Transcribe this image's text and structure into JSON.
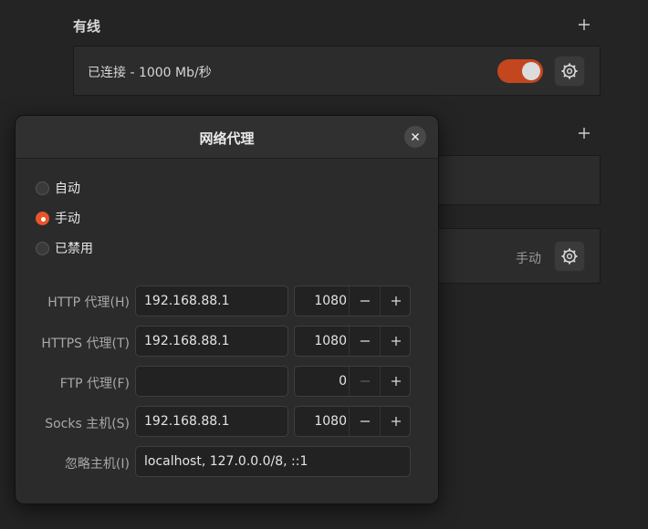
{
  "wired": {
    "section_title": "有线",
    "connection_label": "已连接 - 1000 Mb/秒",
    "connection_enabled": true
  },
  "proxy_row": {
    "value": "手动"
  },
  "dialog": {
    "title": "网络代理",
    "modes": [
      {
        "label": "自动",
        "checked": false
      },
      {
        "label": "手动",
        "checked": true
      },
      {
        "label": "已禁用",
        "checked": false
      }
    ],
    "fields": {
      "http": {
        "label": "HTTP 代理(H)",
        "host": "192.168.88.1",
        "port": "1080"
      },
      "https": {
        "label": "HTTPS 代理(T)",
        "host": "192.168.88.1",
        "port": "1080"
      },
      "ftp": {
        "label": "FTP 代理(F)",
        "host": "",
        "port": "0"
      },
      "socks": {
        "label": "Socks 主机(S)",
        "host": "192.168.88.1",
        "port": "1080"
      },
      "ignore": {
        "label": "忽略主机(I)",
        "value": "localhost, 127.0.0.0/8, ::1"
      }
    }
  },
  "colors": {
    "accent": "#e9552b",
    "toggle_on": "#c4461f"
  }
}
